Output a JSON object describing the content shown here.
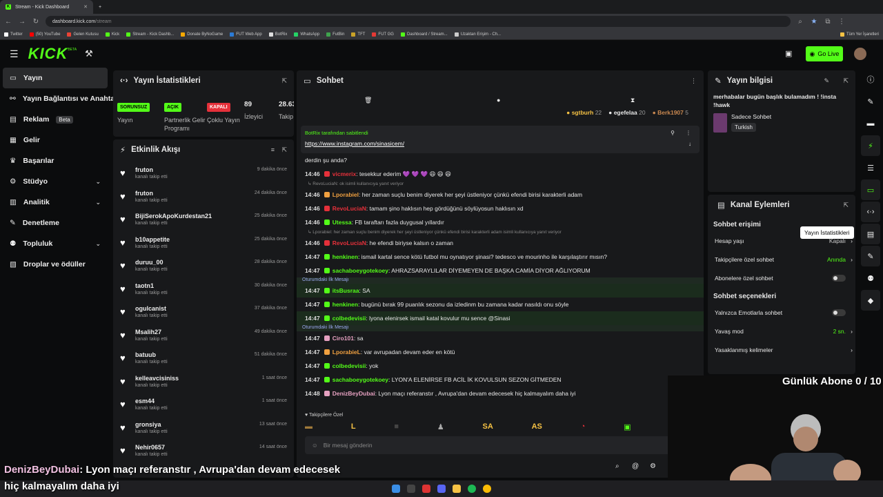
{
  "browser": {
    "tabs": [
      {
        "label": "Stream - Kick Dashboard",
        "active": true
      }
    ],
    "new_tab": "+",
    "url_host": "dashboard.kick.com",
    "url_path": "/stream",
    "bookmarks": [
      "Twitter",
      "(50) YouTube",
      "Gelen Kutusu",
      "Kick",
      "Stream - Kick Dashb...",
      "Donate ByNoGame",
      "FUT Web App",
      "BotRix",
      "WhatsApp",
      "FutBin",
      "TFT",
      "FUT GG",
      "Dashboard / Stream...",
      "Uzaktan Erişim - Ch..."
    ],
    "bookmarks_right": "Tüm Yer İşaretleri"
  },
  "header": {
    "logo": "KICK",
    "logo_sup": "BETA",
    "go_live": "Go Live"
  },
  "sidebar": {
    "items": [
      {
        "label": "Yayın"
      },
      {
        "label": "Yayın Bağlantısı ve Anahtarı"
      },
      {
        "label": "Reklam",
        "badge": "Beta"
      },
      {
        "label": "Gelir"
      },
      {
        "label": "Başarılar"
      },
      {
        "label": "Stüdyo"
      },
      {
        "label": "Analitik"
      },
      {
        "label": "Denetleme"
      },
      {
        "label": "Topluluk"
      },
      {
        "label": "Droplar ve ödüller"
      }
    ]
  },
  "stats": {
    "title": "Yayın İstatistikleri",
    "items": [
      {
        "badge": "SORUNSUZ",
        "label": "Yayın",
        "color": "#53fc18"
      },
      {
        "badge": "AÇIK",
        "label": "Partnerlik Gelir Programı",
        "color": "#53fc18"
      },
      {
        "badge": "KAPALI",
        "label": "Çoklu Yayın",
        "color": "#e5303a"
      },
      {
        "value": "89",
        "label": "İzleyici"
      },
      {
        "value": "28.63",
        "label": "Takip"
      }
    ]
  },
  "activity": {
    "title": "Etkinlik Akışı",
    "sub": "kanalı takip etti",
    "items": [
      {
        "name": "fruton",
        "time": "9 dakika önce"
      },
      {
        "name": "fruton",
        "time": "24 dakika önce"
      },
      {
        "name": "BijiSerokApoKurdestan21",
        "time": "25 dakika önce"
      },
      {
        "name": "b10appetite",
        "time": "25 dakika önce"
      },
      {
        "name": "duruu_00",
        "time": "28 dakika önce"
      },
      {
        "name": "taotn1",
        "time": "30 dakika önce"
      },
      {
        "name": "ogulcanist",
        "time": "37 dakika önce"
      },
      {
        "name": "Msalih27",
        "time": "49 dakika önce"
      },
      {
        "name": "batuub",
        "time": "51 dakika önce"
      },
      {
        "name": "kelleavcisiniss",
        "time": "1 saat önce"
      },
      {
        "name": "esm44",
        "time": "1 saat önce"
      },
      {
        "name": "gronsiya",
        "time": "13 saat önce"
      },
      {
        "name": "Nehir0657",
        "time": "14 saat önce"
      }
    ]
  },
  "chat": {
    "title": "Sohbet",
    "top_users": [
      {
        "name": "sgtburh",
        "count": "22"
      },
      {
        "name": "egefelaa",
        "count": "20"
      },
      {
        "name": "Berk1907",
        "count": "5"
      }
    ],
    "pinned_by": "BotRix tarafından sabitlendi",
    "pinned_link": "https://www.instagram.com/sinasicem/",
    "first_line": "derdin şu anda?",
    "messages": [
      {
        "t": "14:46",
        "u": "vicmerix",
        "c": "#e5303a",
        "m": ": tesekkur ederim 💜 💜 💜 😆 😆 😆"
      },
      {
        "reply": "↳ RevoLuciaN: ok isimli kullanıcıya yanıt veriyor"
      },
      {
        "t": "14:46",
        "u": "Lporabiel",
        "c": "#f0a040",
        "m": ": her zaman suçlu benim diyerek her şeyi üstleniyor çünkü efendi birisi karakterli adam"
      },
      {
        "t": "14:46",
        "u": "RevoLuciaN",
        "c": "#e5303a",
        "m": ": tamam şino haklısın hep gördüğünü söylüyosun haklısın xd"
      },
      {
        "t": "14:46",
        "u": "Utessa",
        "c": "#53fc18",
        "m": ": FB taraftarı fazla duygusal yıllardır"
      },
      {
        "reply": "↳ Lporabiel: her zaman suçlu benim diyerek her şeyi üstleniyor çünkü efendi birisi karakterli adam isimli kullanıcıya yanıt veriyor"
      },
      {
        "t": "14:46",
        "u": "RevoLuciaN",
        "c": "#e5303a",
        "m": ": he efendi biriyse kalsın o zaman"
      },
      {
        "t": "14:47",
        "u": "henkinen",
        "c": "#53fc18",
        "m": ": ismail kartal sence kötü futbol mu oynatıyor şinasi? tedesco ve mourinho ile karşılaştırır mısın?"
      },
      {
        "t": "14:47",
        "u": "sachaboeygotekoey",
        "c": "#53fc18",
        "m": ": AHRAZSARAYLILAR DİYEMEYEN DE BAŞKA CAMİA DİYOR AĞLIYORUM"
      },
      {
        "first": "Oturumdaki İlk Mesajı"
      },
      {
        "t": "14:47",
        "u": "itsBusraa",
        "c": "#53fc18",
        "m": ": SA",
        "hl": true
      },
      {
        "t": "14:47",
        "u": "henkinen",
        "c": "#53fc18",
        "m": ": bugünü bırak 99 puanlık sezonu da izledinm bu zamana kadar nasıldı onu söyle"
      },
      {
        "t": "14:47",
        "u": "colbedevisii",
        "c": "#53fc18",
        "m": ": lyona elenirsek ismail katal kovulur mu sence @Sinasi",
        "hl": true
      },
      {
        "first": "Oturumdaki İlk Mesajı"
      },
      {
        "t": "14:47",
        "u": "Ciro101",
        "c": "#e5a0c0",
        "m": ": sa"
      },
      {
        "t": "14:47",
        "u": "LporabieL",
        "c": "#f0a040",
        "m": ": var avrupadan devam eder en kötü"
      },
      {
        "t": "14:47",
        "u": "colbedevisii",
        "c": "#53fc18",
        "m": ": yok"
      },
      {
        "t": "14:47",
        "u": "sachaboeygotekoey",
        "c": "#53fc18",
        "m": ": LYON'A ELENİRSE FB ACİL İK KOVULSUN SEZON GİTMEDEN"
      },
      {
        "t": "14:48",
        "u": "DenizBeyDubai",
        "c": "#e5a0c0",
        "m": ": Lyon maçı referanstır , Avrupa'dan devam edecesek hiç kalmayalım daha iyi"
      }
    ],
    "emote_label": "♥ Takipçilere Özel",
    "emotes": [
      "L",
      "SA",
      "AS"
    ],
    "input_placeholder": "Bir mesaj gönderin"
  },
  "info": {
    "title": "Yayın bilgisi",
    "stream_title": "merhabalar bugün başlık bulamadım ! !insta !hawk",
    "category": "Sadece Sohbet",
    "language": "Turkish"
  },
  "actions": {
    "title": "Kanal Eylemleri",
    "access_title": "Sohbet erişimi",
    "rows": [
      {
        "label": "Hesap yaşı",
        "value": "Kapalı"
      },
      {
        "label": "Takipçilere özel sohbet",
        "value": "Anında",
        "green": true
      },
      {
        "label": "Abonelere özel sohbet",
        "toggle": true
      }
    ],
    "options_title": "Sohbet seçenekleri",
    "rows2": [
      {
        "label": "Yalnızca Emotlarla sohbet",
        "toggle": true
      },
      {
        "label": "Yavaş mod",
        "value": "2 sn.",
        "green": true
      },
      {
        "label": "Yasaklanmış kelimeler",
        "value": ""
      }
    ]
  },
  "tooltip": "Yayın İstatistikleri",
  "overlay": {
    "sub_goal": "Günlük Abone 0 / 10",
    "caption_user": "DenizBeyDubai",
    "caption_line1": ": Lyon maçı referanstır , Avrupa'dan devam edecesek",
    "caption_line2": "hiç kalmayalım daha iyi"
  }
}
